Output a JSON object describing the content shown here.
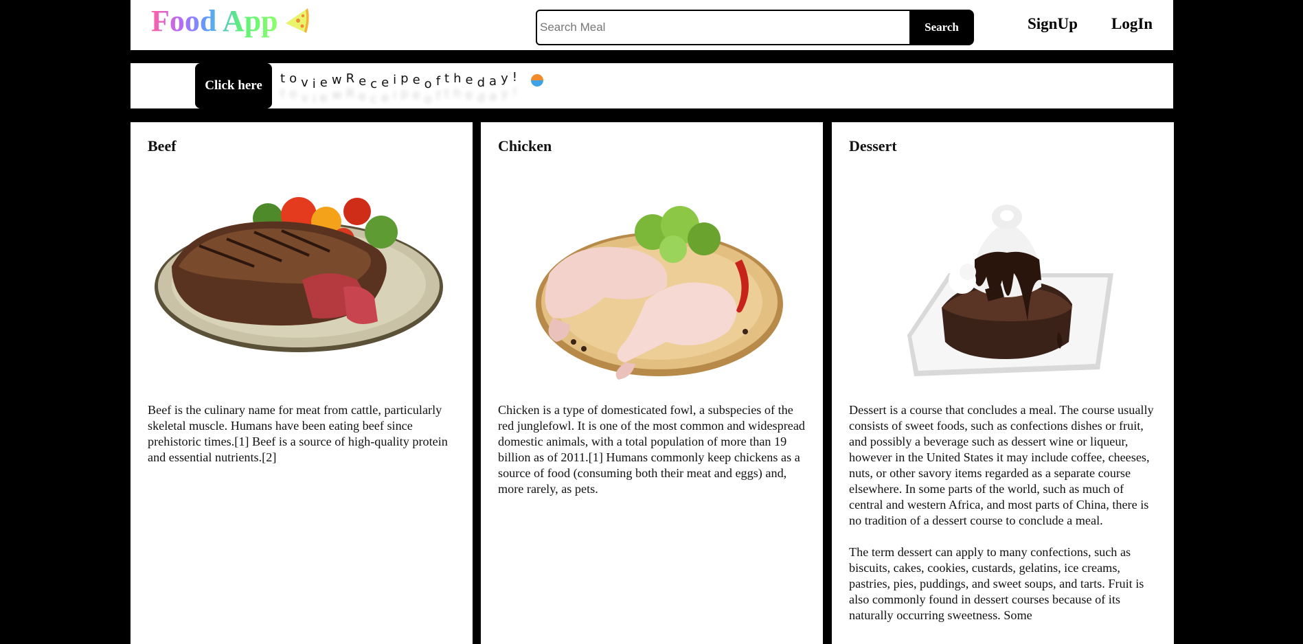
{
  "header": {
    "logo_text": "Food App",
    "logo_icon": "pizza-slice-icon",
    "search": {
      "placeholder": "Search Meal",
      "value": "",
      "button_label": "Search"
    },
    "nav": {
      "signup": "SignUp",
      "login": "LogIn"
    }
  },
  "banner": {
    "button_label": "Click here",
    "message_letters": [
      "t",
      "o",
      " ",
      "v",
      "i",
      "e",
      "w",
      " ",
      "R",
      "e",
      "c",
      "e",
      "i",
      "p",
      "e",
      " ",
      "o",
      "f",
      " ",
      "t",
      "h",
      "e",
      " ",
      "d",
      "a",
      "y",
      "!"
    ],
    "icon": "swirl-icon"
  },
  "cards": [
    {
      "title": "Beef",
      "image": "beef-steak-plate",
      "paragraphs": [
        "Beef is the culinary name for meat from cattle, particularly skeletal muscle. Humans have been eating beef since prehistoric times.[1] Beef is a source of high-quality protein and essential nutrients.[2]"
      ]
    },
    {
      "title": "Chicken",
      "image": "raw-chicken-legs-board",
      "paragraphs": [
        "Chicken is a type of domesticated fowl, a subspecies of the red junglefowl. It is one of the most common and widespread domestic animals, with a total population of more than 19 billion as of 2011.[1] Humans commonly keep chickens as a source of food (consuming both their meat and eggs) and, more rarely, as pets."
      ]
    },
    {
      "title": "Dessert",
      "image": "chocolate-lava-cake-sundae",
      "paragraphs": [
        "Dessert is a course that concludes a meal. The course usually consists of sweet foods, such as confections dishes or fruit, and possibly a beverage such as dessert wine or liqueur, however in the United States it may include coffee, cheeses, nuts, or other savory items regarded as a separate course elsewhere. In some parts of the world, such as much of central and western Africa, and most parts of China, there is no tradition of a dessert course to conclude a meal.",
        "The term dessert can apply to many confections, such as biscuits, cakes, cookies, custards, gelatins, ice creams, pastries, pies, puddings, and sweet soups, and tarts. Fruit is also commonly found in dessert courses because of its naturally occurring sweetness. Some"
      ]
    }
  ],
  "colors": {
    "page_background": "#000000",
    "panel_background": "#ffffff",
    "button_background": "#000000",
    "logo_gradient": [
      "#ff5fa2",
      "#b06cff",
      "#5aa0ff",
      "#5cf07a",
      "#8cff6a"
    ]
  }
}
